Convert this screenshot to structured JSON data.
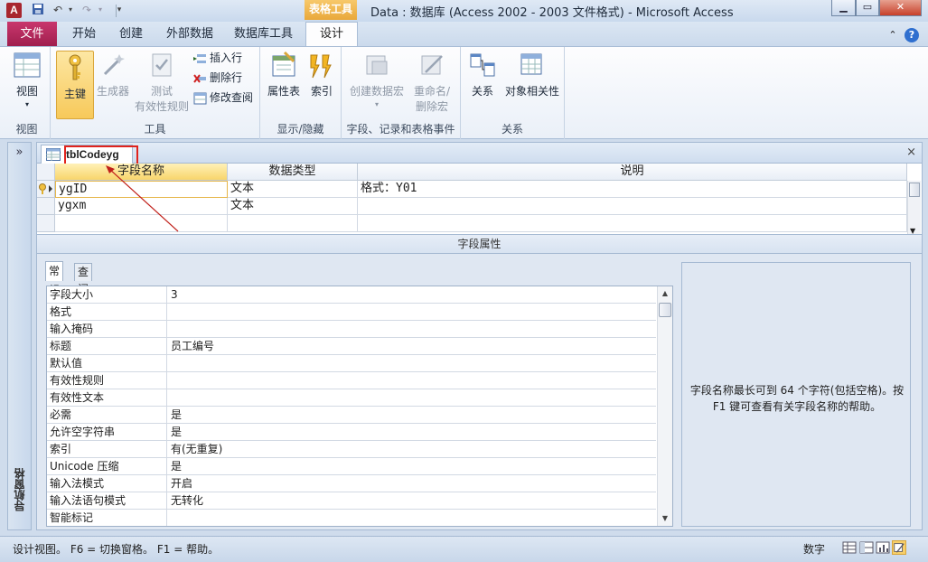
{
  "window": {
    "title": "Data : 数据库 (Access 2002 - 2003 文件格式) - Microsoft Access",
    "context_tab_group": "表格工具",
    "app_icon_letter": "A"
  },
  "tabs": {
    "file": "文件",
    "items": [
      "开始",
      "创建",
      "外部数据",
      "数据库工具"
    ],
    "active": "设计"
  },
  "ribbon": {
    "view_group": {
      "label": "视图",
      "button": "视图"
    },
    "tools_group": {
      "label": "工具",
      "primary_key": "主键",
      "builder": "生成器",
      "test_rules_line1": "测试",
      "test_rules_line2": "有效性规则",
      "insert_rows": "插入行",
      "delete_rows": "删除行",
      "modify_lookups": "修改查阅"
    },
    "show_hide_group": {
      "label": "显示/隐藏",
      "property_sheet": "属性表",
      "indexes": "索引"
    },
    "events_group": {
      "label": "字段、记录和表格事件",
      "create_macros": "创建数据宏",
      "rename_line1": "重命名/",
      "rename_line2": "删除宏"
    },
    "relationships_group": {
      "label": "关系",
      "relationships": "关系",
      "dependencies": "对象相关性"
    }
  },
  "nav_pane": {
    "label": "导航窗格",
    "toggle": "»"
  },
  "document": {
    "tab_title": "tblCodeyg",
    "close": "×",
    "columns": {
      "field_name": "字段名称",
      "data_type": "数据类型",
      "description": "说明"
    },
    "rows": [
      {
        "name": "ygID",
        "type": "文本",
        "desc": "格式：Y01",
        "primary": true
      },
      {
        "name": "ygxm",
        "type": "文本",
        "desc": "",
        "primary": false
      }
    ],
    "field_properties_label": "字段属性"
  },
  "properties": {
    "tabs": [
      "常规",
      "查阅"
    ],
    "rows": [
      {
        "label": "字段大小",
        "value": "3"
      },
      {
        "label": "格式",
        "value": ""
      },
      {
        "label": "输入掩码",
        "value": ""
      },
      {
        "label": "标题",
        "value": "员工编号"
      },
      {
        "label": "默认值",
        "value": ""
      },
      {
        "label": "有效性规则",
        "value": ""
      },
      {
        "label": "有效性文本",
        "value": ""
      },
      {
        "label": "必需",
        "value": "是"
      },
      {
        "label": "允许空字符串",
        "value": "是"
      },
      {
        "label": "索引",
        "value": "有(无重复)"
      },
      {
        "label": "Unicode 压缩",
        "value": "是"
      },
      {
        "label": "输入法模式",
        "value": "开启"
      },
      {
        "label": "输入法语句模式",
        "value": "无转化"
      },
      {
        "label": "智能标记",
        "value": ""
      }
    ],
    "help_text": "字段名称最长可到 64 个字符(包括空格)。按 F1 键可查看有关字段名称的帮助。"
  },
  "status": {
    "text": "设计视图。   F6 = 切换窗格。   F1 = 帮助。",
    "mode": "数字"
  },
  "colors": {
    "file_tab": "#b8285c",
    "context_tab": "#eeb24a",
    "highlight": "#e0231d",
    "selected_header": "#f8d56b"
  }
}
